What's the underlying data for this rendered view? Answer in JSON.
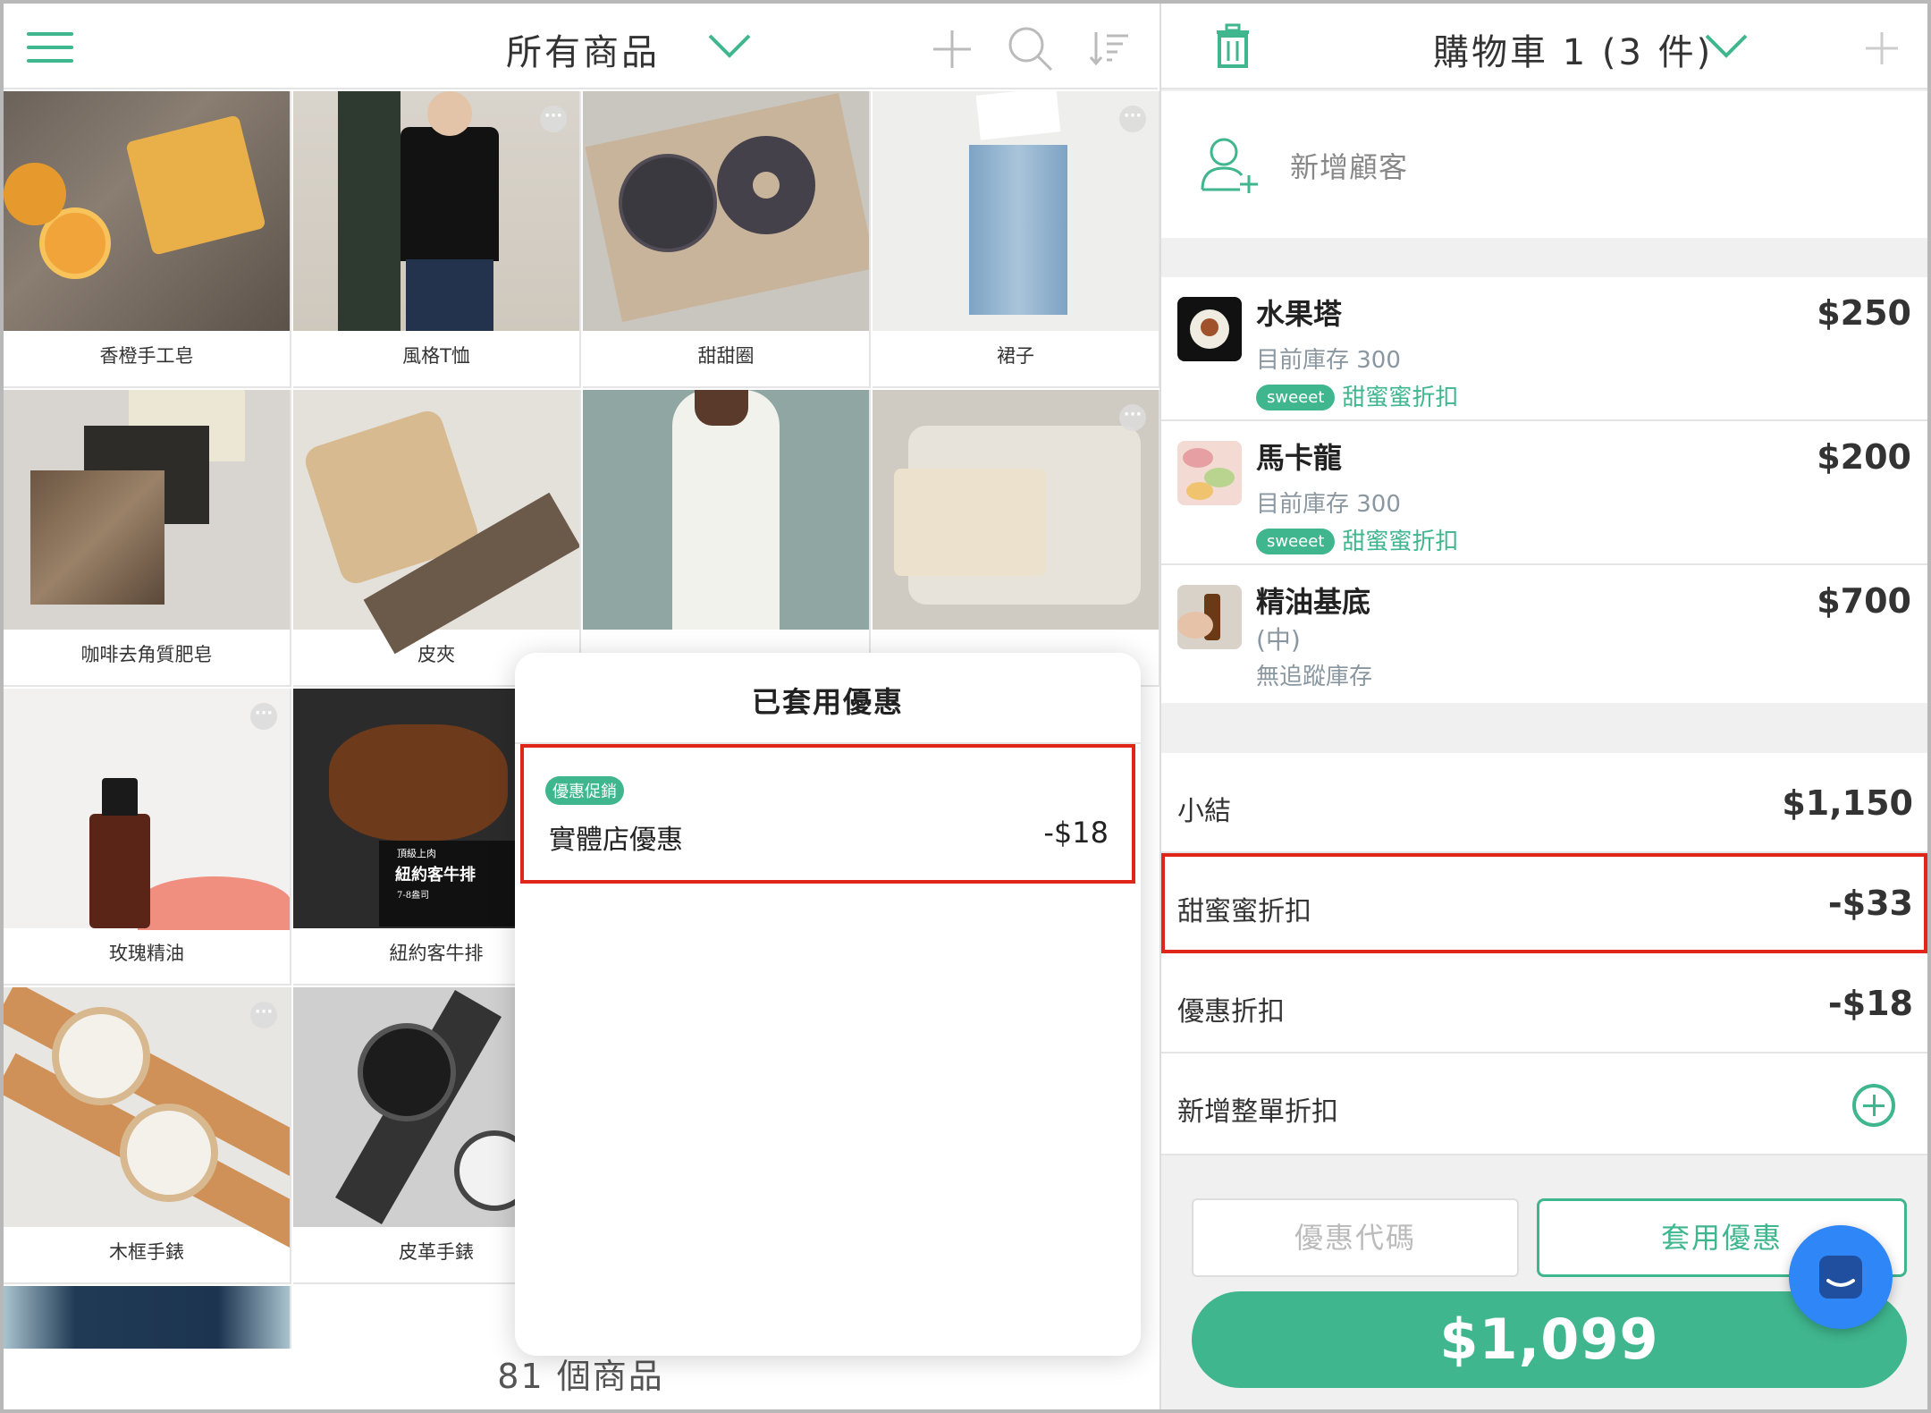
{
  "header": {
    "menu_icon": "hamburger-icon",
    "title": "所有商品",
    "accent": "#3fb68e"
  },
  "products": [
    {
      "name": "香橙手工皂",
      "more": false
    },
    {
      "name": "風格T恤",
      "more": true
    },
    {
      "name": "甜甜圈",
      "more": false
    },
    {
      "name": "裙子",
      "more": true
    },
    {
      "name": "咖啡去角質肥皂",
      "more": false
    },
    {
      "name": "皮夾",
      "more": false
    },
    {
      "name": "",
      "more": false
    },
    {
      "name": "",
      "more": true
    },
    {
      "name": "玫瑰精油",
      "more": true
    },
    {
      "name": "紐約客牛排",
      "more": false
    },
    {
      "name": "木框手錶",
      "more": true
    },
    {
      "name": "皮革手錶",
      "more": false
    }
  ],
  "steak_overlay": {
    "line1": "頂級上肉",
    "line2": "紐約客牛排",
    "line3": "7-8盎司"
  },
  "product_count": "81 個商品",
  "popover": {
    "title": "已套用優惠",
    "item": {
      "tag": "優惠促銷",
      "name": "實體店優惠",
      "value": "-$18"
    }
  },
  "cart": {
    "title": "購物車 1 (3 件)",
    "add_customer": "新增顧客",
    "items": [
      {
        "name": "水果塔",
        "price": "$250",
        "stock": "目前庫存 300",
        "tag": "sweeet",
        "discount": "甜蜜蜜折扣"
      },
      {
        "name": "馬卡龍",
        "price": "$200",
        "stock": "目前庫存 300",
        "tag": "sweeet",
        "discount": "甜蜜蜜折扣"
      },
      {
        "name": "精油基底",
        "price": "$700",
        "variant": "(中)",
        "stock": "無追蹤庫存"
      }
    ],
    "subtotal_label": "小結",
    "subtotal": "$1,150",
    "sweet_label": "甜蜜蜜折扣",
    "sweet_value": "-$33",
    "promo_label": "優惠折扣",
    "promo_value": "-$18",
    "add_order_discount": "新增整單折扣",
    "coupon_placeholder": "優惠代碼",
    "apply_label": "套用優惠",
    "total": "$1,099"
  }
}
